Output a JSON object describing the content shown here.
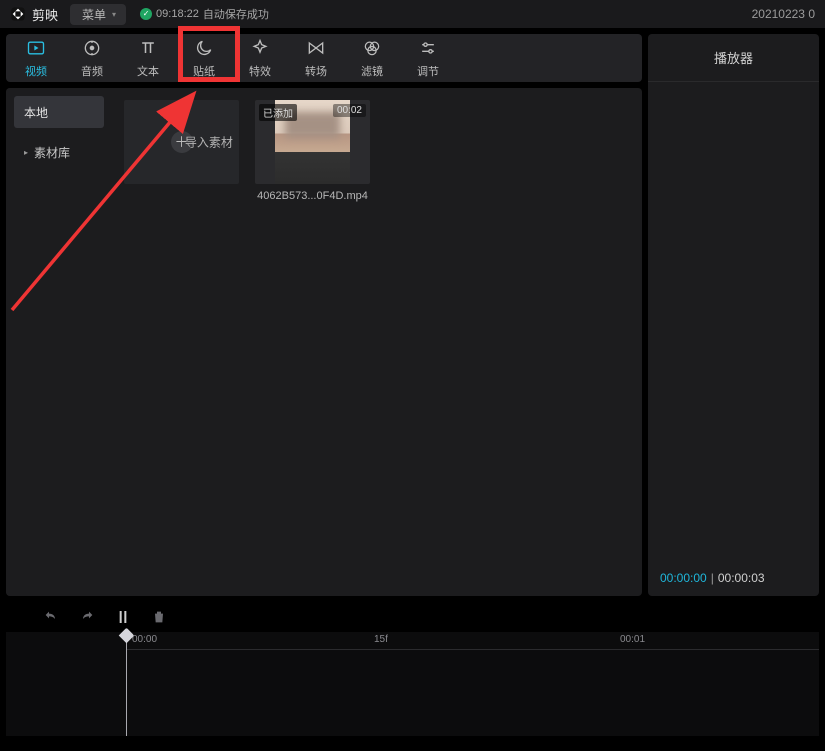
{
  "app": {
    "name": "剪映",
    "menu_label": "菜单"
  },
  "autosave": {
    "time": "09:18:22",
    "status": "自动保存成功"
  },
  "right_date": "20210223 0",
  "top_tabs": [
    {
      "id": "video",
      "label": "视频"
    },
    {
      "id": "audio",
      "label": "音频"
    },
    {
      "id": "text",
      "label": "文本"
    },
    {
      "id": "sticker",
      "label": "贴纸"
    },
    {
      "id": "effect",
      "label": "特效"
    },
    {
      "id": "transition",
      "label": "转场"
    },
    {
      "id": "filter",
      "label": "滤镜"
    },
    {
      "id": "adjust",
      "label": "调节"
    }
  ],
  "sidebar": {
    "local": "本地",
    "library": "素材库"
  },
  "import_tile": {
    "label": "导入素材"
  },
  "clip": {
    "badge": "已添加",
    "duration": "00:02",
    "filename": "4062B573...0F4D.mp4"
  },
  "player": {
    "title": "播放器",
    "current": "00:00:00",
    "total": "00:00:03"
  },
  "timeline": {
    "t0": "00:00",
    "mid": "15f",
    "t1": "00:01"
  }
}
